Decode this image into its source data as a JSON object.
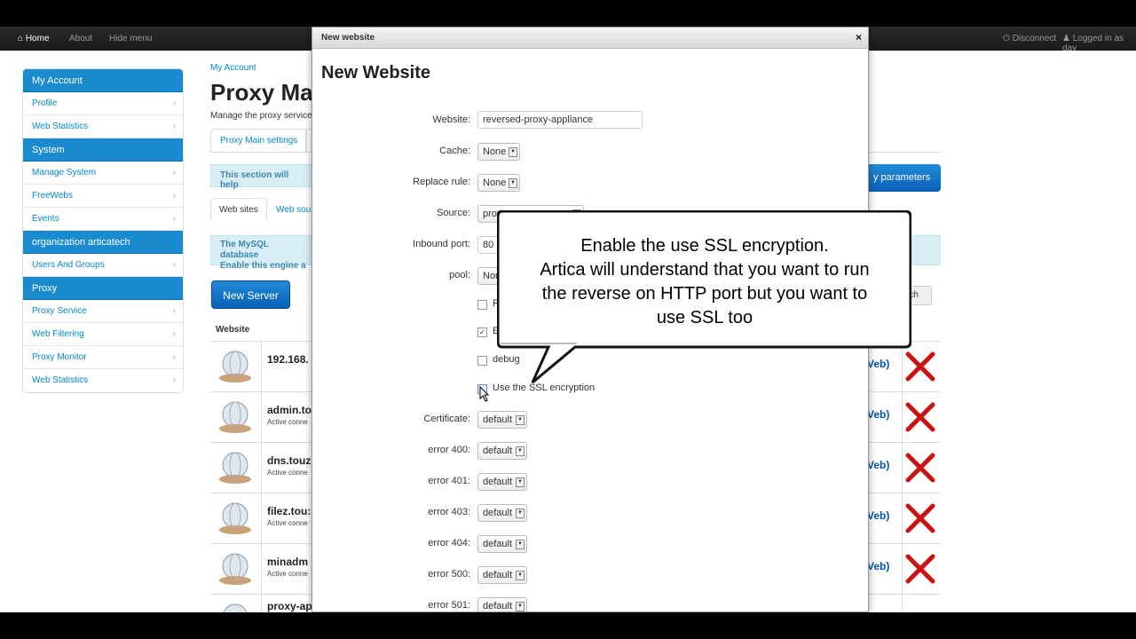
{
  "topbar": {
    "home": "Home",
    "about": "About",
    "hide_menu": "Hide menu",
    "disconnect": "Disconnect",
    "logged_in": "Logged in as dav"
  },
  "sidebar": {
    "sections": [
      {
        "title": "My Account",
        "items": [
          "Profile",
          "Web Statistics"
        ]
      },
      {
        "title": "System",
        "items": [
          "Manage System",
          "FreeWebs",
          "Events"
        ]
      },
      {
        "title": "organization articatech",
        "items": [
          "Users And Groups"
        ]
      },
      {
        "title": "Proxy",
        "items": [
          "Proxy Service",
          "Web Filtering",
          "Proxy Monitor",
          "Web Statistics"
        ]
      }
    ]
  },
  "main": {
    "breadcrumb": "My Account",
    "title": "Proxy Ma",
    "subtitle": "Manage the proxy service",
    "tab_main": "Proxy Main settings",
    "info1": "This section will help",
    "tab_websites": "Web sites",
    "tab_websources": "Web sou",
    "info2_line1": "The MySQL database",
    "info2_line2": "Enable this engine a",
    "new_server": "New Server",
    "params_button": "y parameters",
    "search_button": "rch",
    "table_header": "Website",
    "rows": [
      {
        "name": "192.168.",
        "sub": "",
        "link": "Veb)"
      },
      {
        "name": "admin.to",
        "sub": "Active conne",
        "link": "Veb)"
      },
      {
        "name": "dns.touz",
        "sub": "Active conne",
        "link": "Veb)"
      },
      {
        "name": "filez.tou:",
        "sub": "Active conne",
        "link": "Veb)"
      },
      {
        "name": "minadm",
        "sub": "Active conne",
        "link": "Veb)"
      },
      {
        "name": "proxy-ap",
        "sub": "",
        "link": ""
      }
    ]
  },
  "modal": {
    "header": "New website",
    "close": "×",
    "title": "New Website",
    "website_label": "Website:",
    "website_value": "reversed-proxy-appliance",
    "cache_label": "Cache:",
    "cache_value": "None",
    "replace_label": "Replace rule:",
    "replace_value": "None",
    "source_label": "Source:",
    "source_value": "prox",
    "inbound_label": "Inbound port:",
    "inbound_value": "80",
    "pool_label": "pool:",
    "pool_value": "Nor",
    "chk1_label": "F",
    "chk2_label": "E",
    "debug_label": "debug",
    "ssl_label": "Use the SSL encryption",
    "certificate_label": "Certificate:",
    "certificate_value": "default",
    "errors": [
      {
        "label": "error 400:",
        "value": "default"
      },
      {
        "label": "error 401:",
        "value": "default"
      },
      {
        "label": "error 403:",
        "value": "default"
      },
      {
        "label": "error 404:",
        "value": "default"
      },
      {
        "label": "error 500:",
        "value": "default"
      },
      {
        "label": "error 501:",
        "value": "default"
      }
    ]
  },
  "callout": {
    "line1": "Enable the use SSL encryption.",
    "line2": "Artica will understand that you want to run",
    "line3": "the reverse on HTTP port but you want to",
    "line4": "use SSL too"
  },
  "colors": {
    "accent": "#1b8bd0",
    "link": "#0088cc",
    "info_bg": "#d9edf7",
    "delete": "#cc1111"
  }
}
